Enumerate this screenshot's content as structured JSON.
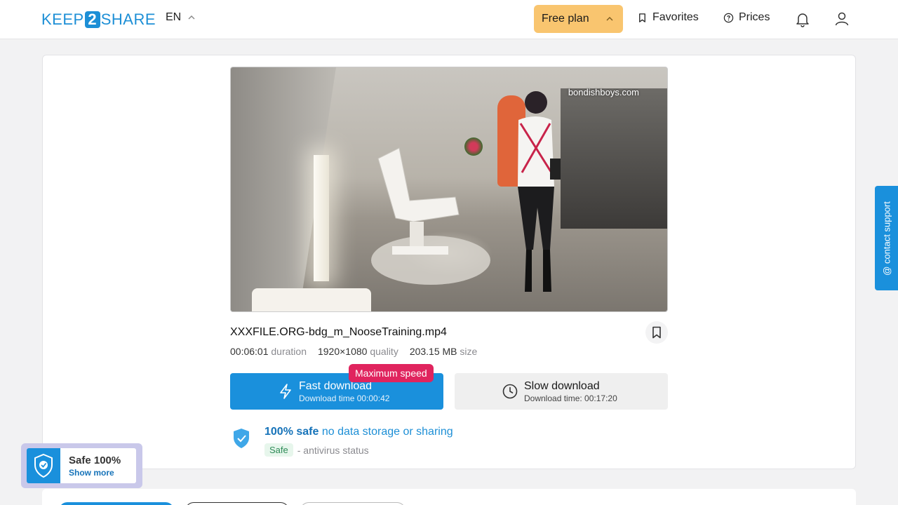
{
  "header": {
    "logo_left": "KEEP",
    "logo_num": "2",
    "logo_right": "SHARE",
    "language": "EN",
    "plan_label": "Free plan",
    "favorites_label": "Favorites",
    "prices_label": "Prices"
  },
  "file": {
    "watermark": "bondishboys.com",
    "name": "XXXFILE.ORG-bdg_m_NooseTraining.mp4",
    "duration_value": "00:06:01",
    "duration_label": "duration",
    "quality_value": "1920×1080",
    "quality_label": "quality",
    "size_value": "203.15 MB",
    "size_label": "size"
  },
  "download": {
    "fast_label": "Fast download",
    "fast_time": "Download time 00:00:42",
    "badge": "Maximum speed",
    "slow_label": "Slow download",
    "slow_time": "Download time: 00:17:20"
  },
  "safety": {
    "strong": "100% safe",
    "rest": "no data storage or sharing",
    "tag": "Safe",
    "status_text": "- antivirus status"
  },
  "support_label": "@ contact support",
  "safe_widget": {
    "title": "Safe 100%",
    "more": "Show more"
  },
  "colors": {
    "accent": "#1a90dc",
    "plan": "#f9c56f",
    "badge": "#e0245e"
  }
}
